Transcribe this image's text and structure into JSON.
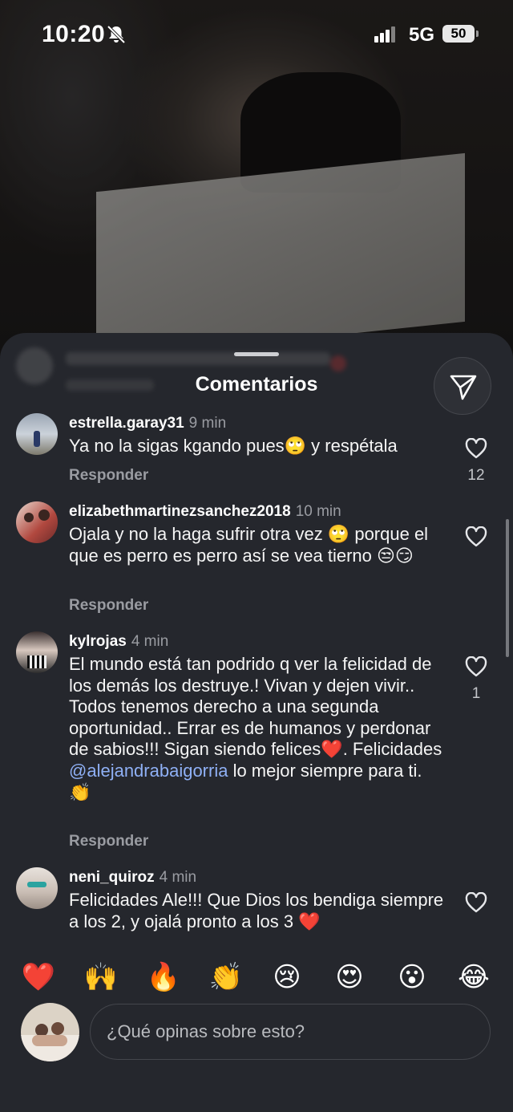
{
  "status_bar": {
    "time": "10:20",
    "network": "5G",
    "battery": "50"
  },
  "sheet": {
    "title": "Comentarios"
  },
  "comments": [
    {
      "username": "estrella.garay31",
      "time": "9 min",
      "text": "Ya no la sigas kgando pues🙄 y respétala",
      "reply_label": "Responder",
      "likes": "12"
    },
    {
      "username": "elizabethmartinezsanchez2018",
      "time": "10 min",
      "text": "Ojala y no la haga sufrir otra vez 🙄 porque el que es perro es perro así se vea tierno 😒😏",
      "reply_label": "Responder",
      "likes": ""
    },
    {
      "username": "kylrojas",
      "time": "4 min",
      "text_before": "El mundo está tan podrido q ver la felicidad de los demás los destruye.! Vivan y dejen vivir.. Todos tenemos derecho a una segunda oportunidad.. Errar es de humanos y perdonar de sabios!!! Sigan siendo felices❤️. Felicidades ",
      "mention": "@alejandrabaigorria",
      "text_after": " lo mejor siempre para ti. 👏",
      "reply_label": "Responder",
      "likes": "1"
    },
    {
      "username": "neni_quiroz",
      "time": "4 min",
      "text": "Felicidades Ale!!! Que Dios los bendiga siempre a los 2, y ojalá pronto a los 3 ❤️",
      "likes": ""
    }
  ],
  "emoji_reactions": [
    "❤️",
    "🙌",
    "🔥",
    "👏",
    "😢",
    "😍",
    "😮",
    "😂"
  ],
  "composer": {
    "placeholder": "¿Qué opinas sobre esto?"
  },
  "colors": {
    "sheet_bg": "#25272d",
    "mention": "#8fb0f5",
    "muted": "#9a9ca2"
  },
  "icons": [
    "bell-slash-icon",
    "cellular-signal-icon",
    "battery-icon",
    "send-icon",
    "heart-outline-icon"
  ]
}
